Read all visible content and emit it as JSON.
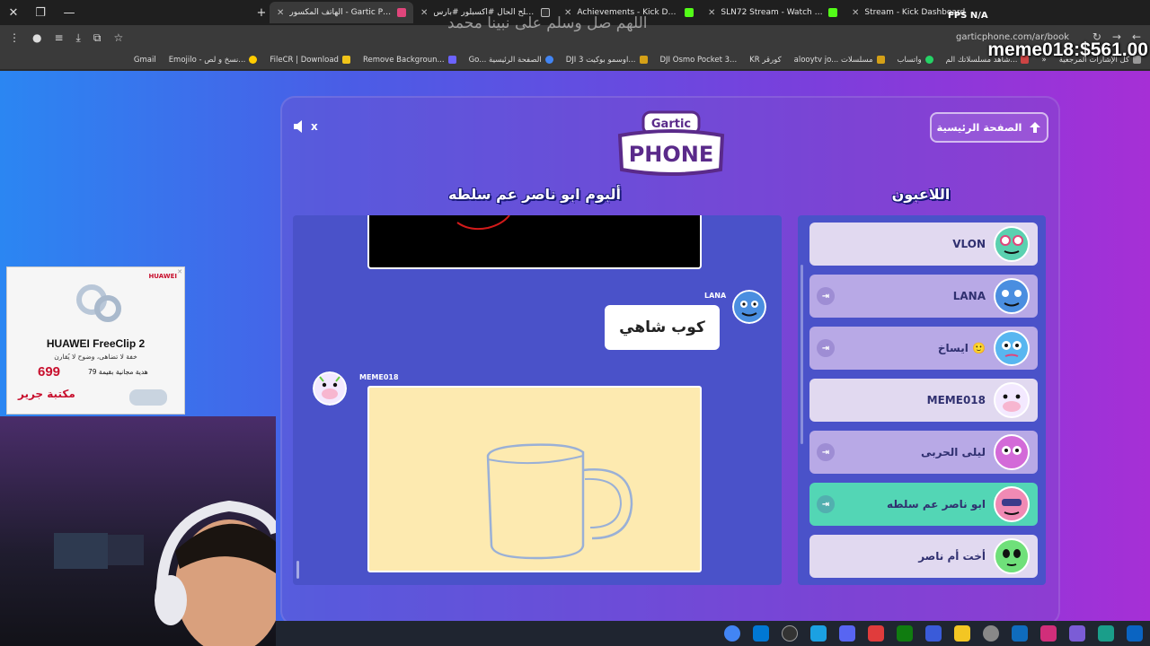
{
  "browser": {
    "tabs": [
      {
        "title": "الهاتف المكسور - Gartic Phone",
        "active": true
      },
      {
        "title": "الله يصلح الحال #اكسبلور #بارس",
        "active": false
      },
      {
        "title": "Achievements - Kick Dashboard",
        "active": false
      },
      {
        "title": "SLN72 Stream - Watch Live on",
        "active": false
      },
      {
        "title": "Stream - Kick Dashboard",
        "active": false
      }
    ],
    "url": "garticphone.com/ar/book",
    "bookmarks": [
      "كل الإشارات المرجعية",
      "شاهد مسلسلاتك الم...",
      "واتساب",
      "alooytv jo... مسلسلات",
      "KR كورقر",
      "DJI Osmo Pocket 3...",
      "DJI اوسمو بوكيت 3...",
      "Go... الصفحة الرئيسية",
      "Remove Backgroun...",
      "FileCR | Download",
      "Emojilo - نسخ و لص...",
      "Gmail"
    ]
  },
  "overlay": {
    "money": "meme018:$561.00",
    "dua": "اللهم صل وسلم على نبينا محمد",
    "fps_label": "FPS",
    "fps_value": "N/A"
  },
  "game": {
    "home_button": "الصفحة الرئيسية",
    "logo_top": "Gartic",
    "logo_bottom": "PHONE",
    "album_title": "ألبوم ابو ناصر عم سلطه",
    "players_title": "اللاعبون",
    "album": {
      "guess_author": "LANA",
      "guess_text": "كوب شاهي",
      "drawing_author": "MEME018"
    },
    "players": [
      {
        "name": "VLON",
        "state": "present",
        "color": "#5ad1b0"
      },
      {
        "name": "LANA",
        "state": "absent",
        "color": "#4a8ee0"
      },
      {
        "name": "ايساخ 🙂",
        "state": "absent",
        "color": "#58b6f0"
      },
      {
        "name": "MEME018",
        "state": "present",
        "color": "#f3e9ff"
      },
      {
        "name": "ليلى الحربى",
        "state": "absent",
        "color": "#d36ad8"
      },
      {
        "name": "ابو ناصر عم سلطه",
        "state": "active",
        "color": "#f08ab4"
      },
      {
        "name": "أخت أم ناصر",
        "state": "present",
        "color": "#6fe07a"
      }
    ]
  },
  "ad": {
    "brand": "HUAWEI",
    "title": "HUAWEI FreeClip 2",
    "subtitle": "خفة لا تضاهى، وضوح لا يُقارن",
    "price": "699",
    "gift": "هدية مجانية بقيمة 79",
    "store": "مكتبة جرير"
  }
}
